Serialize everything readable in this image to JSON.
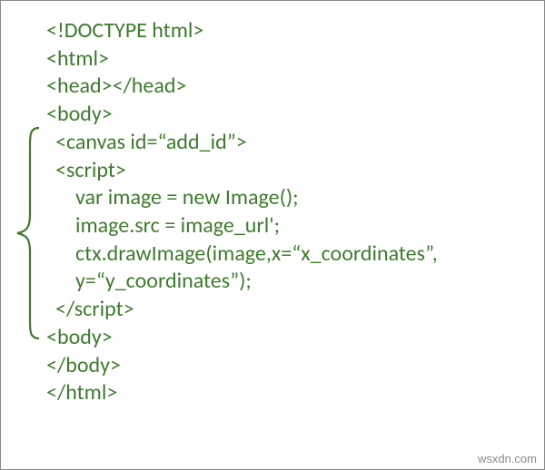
{
  "code": {
    "l1": "<!DOCTYPE html>",
    "l2": "<html>",
    "l3": "<head></head>",
    "l4": "<body>",
    "l5": "<canvas id=“add_id”>",
    "l6": "<script>",
    "l7": "var image = new Image();",
    "l8": "image.src = image_url';",
    "l9": "ctx.drawImage(image,x=“x_coordinates”,",
    "l10": "y=“y_coordinates”);",
    "l11": "</script>",
    "l12": "<body>",
    "l13": "</body>",
    "l14": "</html>"
  },
  "watermark": "wsxdn.com",
  "brace_color": "#3f7a2e"
}
